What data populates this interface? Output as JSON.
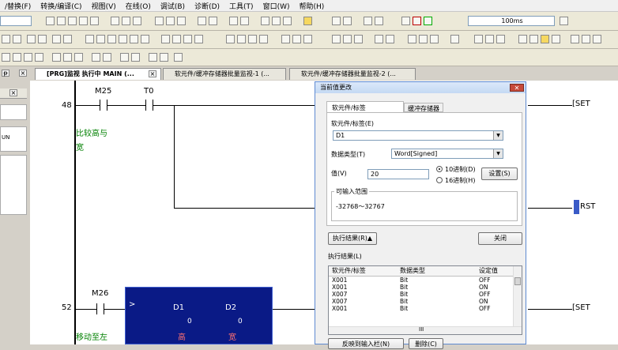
{
  "menu": [
    "/替换(F)",
    "转换/编译(C)",
    "视图(V)",
    "在线(O)",
    "调试(B)",
    "诊断(D)",
    "工具(T)",
    "窗口(W)",
    "帮助(H)"
  ],
  "toolbar": {
    "interval": "100ms"
  },
  "tabs": [
    {
      "label": "[PRG]监视 执行中 MAIN (...",
      "active": true
    },
    {
      "label": "软元件/缓冲存储器批量监视-1 (...",
      "active": false
    },
    {
      "label": "软元件/缓冲存储器批量监视-2 (...",
      "active": false
    }
  ],
  "left_panel": {
    "small_text": "UN"
  },
  "ladder": {
    "rung48": {
      "step": "48",
      "contact1": "M25",
      "contact2": "T0",
      "comment_line1": "比较高与",
      "comment_line2": "宽",
      "coil_set": "SET",
      "coil_rst": "RST"
    },
    "rung52": {
      "step": "52",
      "contact": "M26",
      "comment": "移动至左",
      "coil_set": "SET"
    },
    "fblock": {
      "op": ">",
      "arg1": "D1",
      "arg2": "D2",
      "val1": "0",
      "val2": "0",
      "cmt1": "高",
      "cmt2": "宽"
    }
  },
  "dialog": {
    "title": "当前值更改",
    "tab_device": "软元件/标签",
    "tab_buffer": "缓冲存储器",
    "device_label": "软元件/标签(E)",
    "device_value": "D1",
    "dtype_label": "数据类型(T)",
    "dtype_value": "Word[Signed]",
    "value_label": "值(V)",
    "value": "20",
    "radio_dec": "10进制(D)",
    "radio_hex": "16进制(H)",
    "set_button": "设置(S)",
    "range_label": "可输入范围",
    "range_value": "-32768～32767",
    "result_toggle": "执行结果(R)▲",
    "close_button": "关闭",
    "result_label": "执行结果(L)",
    "columns": [
      "软元件/标签",
      "数据类型",
      "设定值"
    ],
    "rows": [
      {
        "device": "X001",
        "type": "Bit",
        "value": "OFF"
      },
      {
        "device": "X001",
        "type": "Bit",
        "value": "ON"
      },
      {
        "device": "X007",
        "type": "Bit",
        "value": "OFF"
      },
      {
        "device": "X007",
        "type": "Bit",
        "value": "ON"
      },
      {
        "device": "X001",
        "type": "Bit",
        "value": "OFF"
      }
    ],
    "hscroll_mid": "III",
    "bottom_btn1": "反映到输入栏(N)",
    "bottom_btn2": "删除(C)"
  },
  "colors": {
    "function_block": "#0a1a86",
    "comment_text": "#008000",
    "dialog_border": "#5e8ad1"
  }
}
